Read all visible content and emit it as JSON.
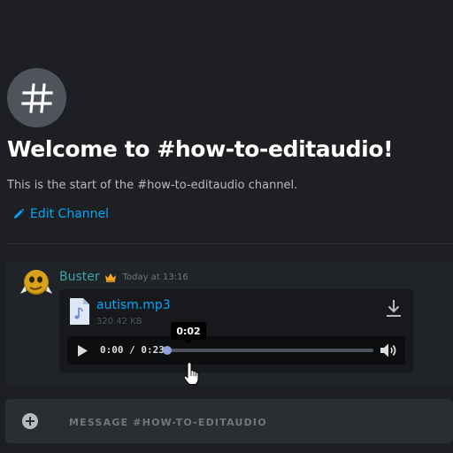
{
  "welcome": {
    "title": "Welcome to #how-to-editaudio!",
    "subtitle": "This is the start of the #how-to-editaudio channel.",
    "edit_channel_label": "Edit Channel"
  },
  "message": {
    "author": "Buster",
    "timestamp": "Today at 13:16",
    "attachment": {
      "file_name": "autism.mp3",
      "file_size": "320.42 KB",
      "player": {
        "time_display": "0:00 / 0:23",
        "progress_fraction": 0,
        "hover_tooltip": "0:02"
      }
    }
  },
  "composer": {
    "placeholder": "MESSAGE #HOW-TO-EDITAUDIO"
  },
  "icons": {
    "channel": "hash-icon",
    "edit": "pencil-icon",
    "badge": "crown-icon",
    "file": "audio-file-icon",
    "download": "download-icon",
    "play": "play-icon",
    "volume": "volume-icon",
    "add": "plus-circle-icon",
    "cursor": "hand-pointer-cursor"
  },
  "colors": {
    "background": "#1d1f22",
    "link": "#00a8fc",
    "author": "#3aa4a6",
    "progress": "#7289da",
    "crown": "#faa61a"
  }
}
